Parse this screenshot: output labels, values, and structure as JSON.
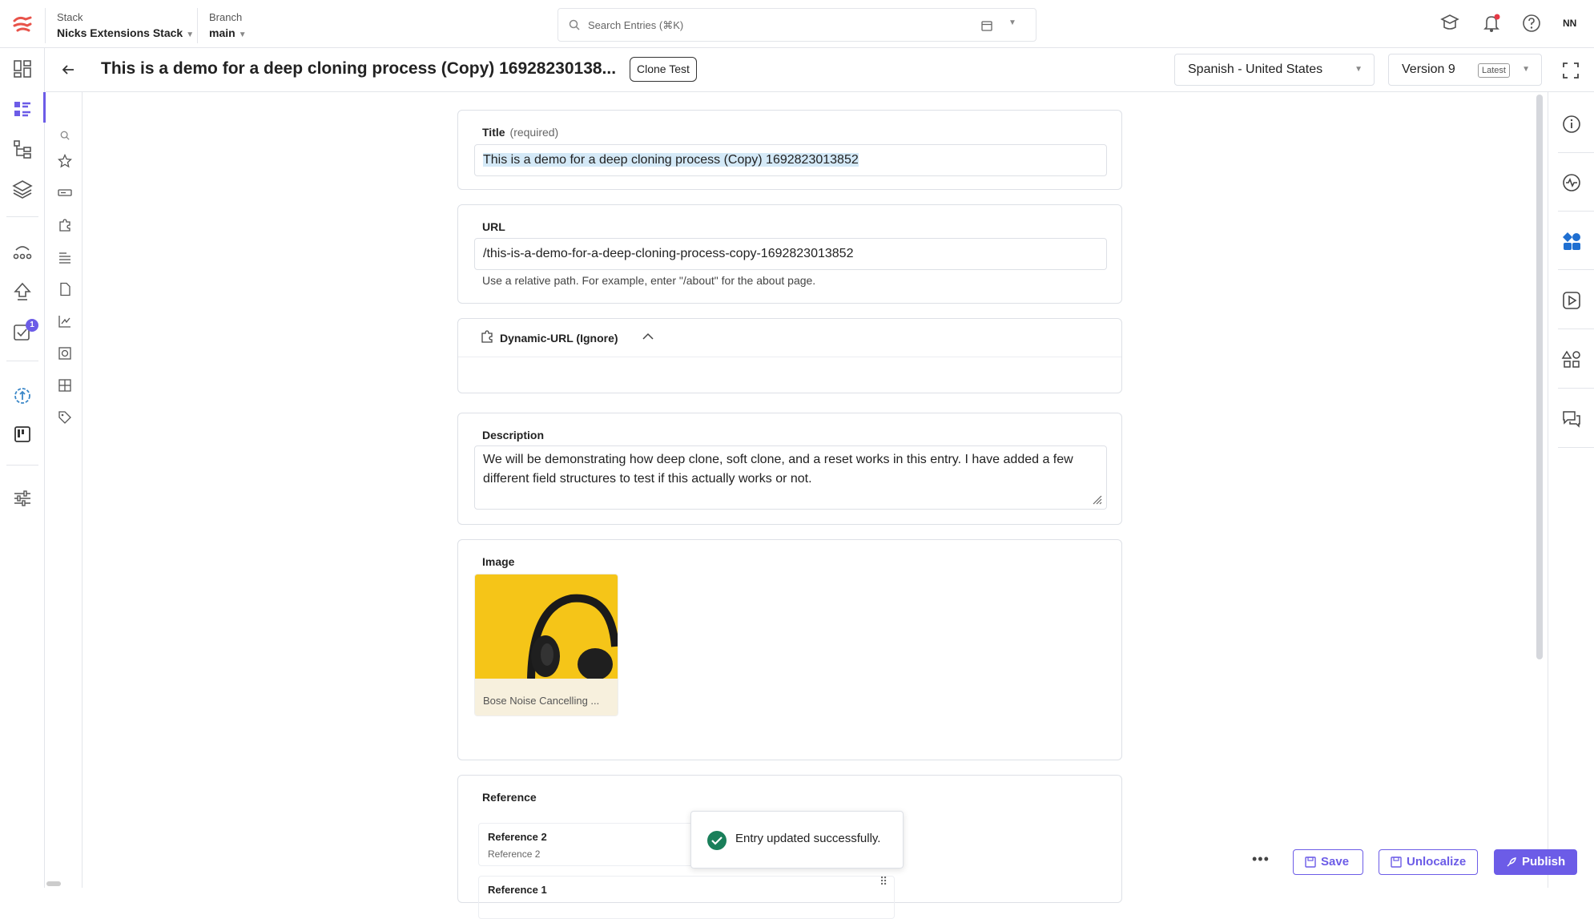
{
  "topbar": {
    "stack_label": "Stack",
    "stack_value": "Nicks Extensions Stack",
    "branch_label": "Branch",
    "branch_value": "main",
    "search_placeholder": "Search Entries (⌘K)",
    "user_initials": "NN"
  },
  "header": {
    "title": "This is a demo for a deep cloning process (Copy) 16928230138...",
    "tag": "Clone Test",
    "locale": "Spanish - United States",
    "version": "Version 9",
    "version_badge": "Latest"
  },
  "left_nav": {
    "badge_count": "1"
  },
  "fields": {
    "title_label": "Title",
    "title_required": "(required)",
    "title_value": "This is a demo for a deep cloning process (Copy) 1692823013852",
    "url_label": "URL",
    "url_value": "/this-is-a-demo-for-a-deep-cloning-process-copy-1692823013852",
    "url_help": "Use a relative path. For example, enter \"/about\" for the about page.",
    "dynamic_url_label": "Dynamic-URL (Ignore)",
    "description_label": "Description",
    "description_value": "We will be demonstrating how deep clone, soft clone, and a reset works in this entry. I have added a few different field structures to test if this actually works or not.",
    "image_label": "Image",
    "image_caption": "Bose Noise Cancelling ...",
    "reference_label": "Reference",
    "references": [
      {
        "title": "Reference 2",
        "subtitle": "Reference 2"
      },
      {
        "title": "Reference 1",
        "subtitle": ""
      }
    ]
  },
  "toast": {
    "message": "Entry updated successfully."
  },
  "actions": {
    "more": "•••",
    "save": "Save",
    "unlocalize": "Unlocalize",
    "publish": "Publish"
  },
  "colors": {
    "accent": "#6c5ce7",
    "success": "#1a7f5a",
    "notification_dot": "#e63946",
    "highlight": "#d4e9f7"
  }
}
